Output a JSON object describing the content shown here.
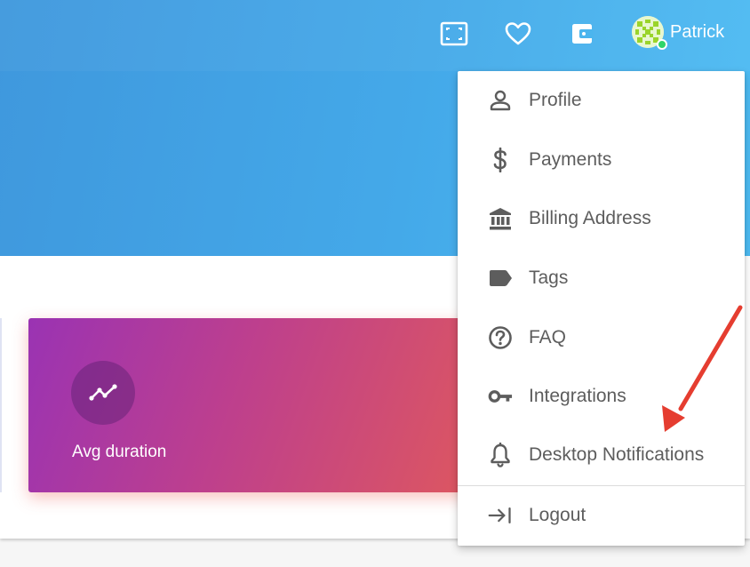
{
  "header": {
    "icons": [
      "fullscreen-icon",
      "heart-icon",
      "wallet-icon"
    ],
    "user": {
      "name": "Patrick",
      "status_color": "#2fd56a"
    }
  },
  "card": {
    "icon": "trending-icon",
    "label": "Avg duration"
  },
  "menu": {
    "items": [
      {
        "label": "Profile",
        "icon": "person-icon"
      },
      {
        "label": "Payments",
        "icon": "dollar-icon"
      },
      {
        "label": "Billing Address",
        "icon": "bank-icon"
      },
      {
        "label": "Tags",
        "icon": "tag-icon"
      },
      {
        "label": "FAQ",
        "icon": "help-circle-icon"
      },
      {
        "label": "Integrations",
        "icon": "key-icon"
      },
      {
        "label": "Desktop Notifications",
        "icon": "bell-icon"
      }
    ],
    "logout": {
      "label": "Logout",
      "icon": "logout-icon"
    }
  },
  "colors": {
    "header_gradient_start": "#3f98dd",
    "header_gradient_end": "#4dbcf3",
    "card_gradient_start": "#9a33b3",
    "card_gradient_end": "#dd5760",
    "menu_text": "#5d5d5d",
    "annotation_arrow": "#e53d30"
  }
}
